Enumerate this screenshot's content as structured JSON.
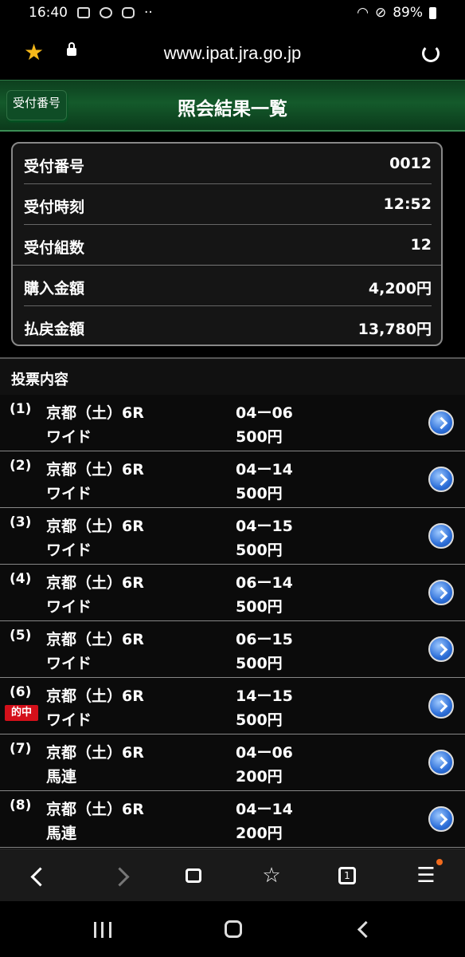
{
  "status_bar": {
    "time": "16:40",
    "notification_icons": [
      "image-icon",
      "hotspot-icon",
      "instagram-icon",
      "more-dots-icon"
    ],
    "battery": "89%"
  },
  "browser": {
    "url": "www.ipat.jra.go.jp"
  },
  "header": {
    "back_label": "受付番号",
    "title": "照会結果一覧"
  },
  "summary": [
    {
      "label": "受付番号",
      "value": "0012"
    },
    {
      "label": "受付時刻",
      "value": "12:52"
    },
    {
      "label": "受付組数",
      "value": "12"
    },
    {
      "label": "購入金額",
      "value": "4,200円"
    },
    {
      "label": "払戻金額",
      "value": "13,780円"
    }
  ],
  "section_title": "投票内容",
  "bets": [
    {
      "num": "(1)",
      "race": "京都（土）6R",
      "type": "ワイド",
      "combo": "04ー06",
      "amount": "500円",
      "hit": ""
    },
    {
      "num": "(2)",
      "race": "京都（土）6R",
      "type": "ワイド",
      "combo": "04ー14",
      "amount": "500円",
      "hit": ""
    },
    {
      "num": "(3)",
      "race": "京都（土）6R",
      "type": "ワイド",
      "combo": "04ー15",
      "amount": "500円",
      "hit": ""
    },
    {
      "num": "(4)",
      "race": "京都（土）6R",
      "type": "ワイド",
      "combo": "06ー14",
      "amount": "500円",
      "hit": ""
    },
    {
      "num": "(5)",
      "race": "京都（土）6R",
      "type": "ワイド",
      "combo": "06ー15",
      "amount": "500円",
      "hit": ""
    },
    {
      "num": "(6)",
      "race": "京都（土）6R",
      "type": "ワイド",
      "combo": "14ー15",
      "amount": "500円",
      "hit": "的中"
    },
    {
      "num": "(7)",
      "race": "京都（土）6R",
      "type": "馬連",
      "combo": "04ー06",
      "amount": "200円",
      "hit": ""
    },
    {
      "num": "(8)",
      "race": "京都（土）6R",
      "type": "馬連",
      "combo": "04ー14",
      "amount": "200円",
      "hit": ""
    }
  ],
  "browser_nav": {
    "tab_count": "1"
  },
  "colors": {
    "header_green": "#145a2b",
    "hit_red": "#d4101a",
    "arrow_blue": "#2c6ed8",
    "star_yellow": "#f6b81a"
  }
}
